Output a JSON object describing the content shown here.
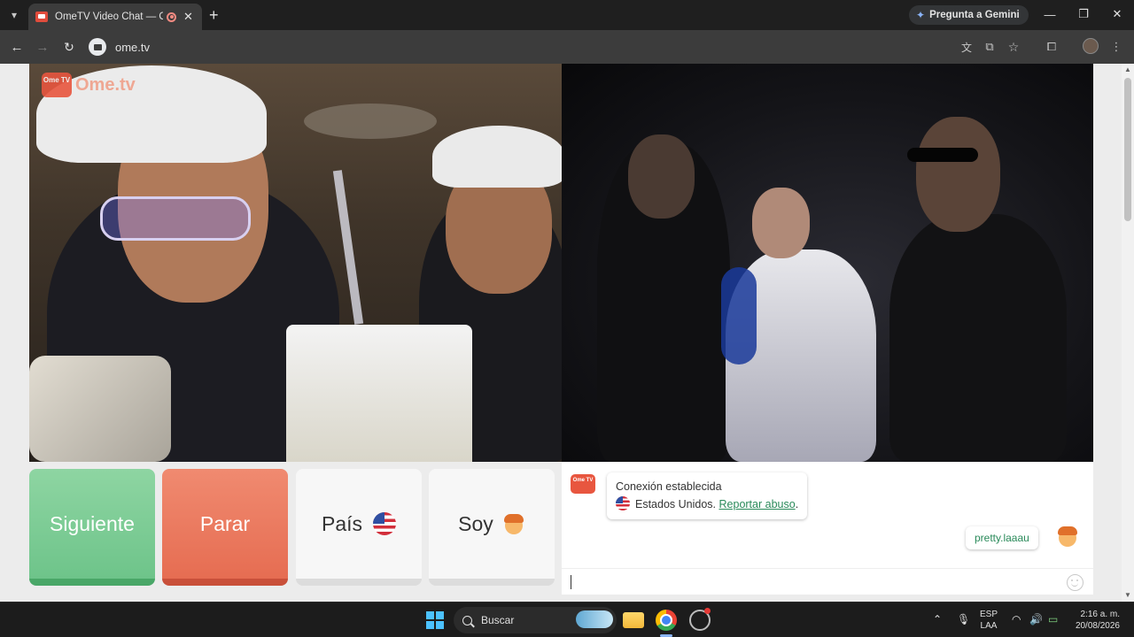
{
  "browser": {
    "tab_title": "OmeTV Video Chat — Ome",
    "tab_close": "✕",
    "new_tab": "+",
    "gemini_label": "Pregunta a Gemini",
    "url": "ome.tv",
    "window_controls": {
      "minimize": "—",
      "maximize": "❐",
      "close": "✕"
    }
  },
  "page": {
    "logo_text": "Ome.tv",
    "logo_icon_text": "Ome TV",
    "buttons": {
      "next": "Siguiente",
      "stop": "Parar",
      "country": "País",
      "gender": "Soy"
    },
    "chat": {
      "logo_icon_text": "Ome TV",
      "system_title": "Conexión establecida",
      "country": "Estados Unidos.",
      "report_link": "Reportar abuso",
      "report_suffix": ".",
      "user_message": "pretty.laaau",
      "input_value": ""
    }
  },
  "taskbar": {
    "search_label": "Buscar",
    "language_top": "ESP",
    "language_bottom": "LAA",
    "time": "2:16 a. m.",
    "date": "20/08/2026"
  }
}
